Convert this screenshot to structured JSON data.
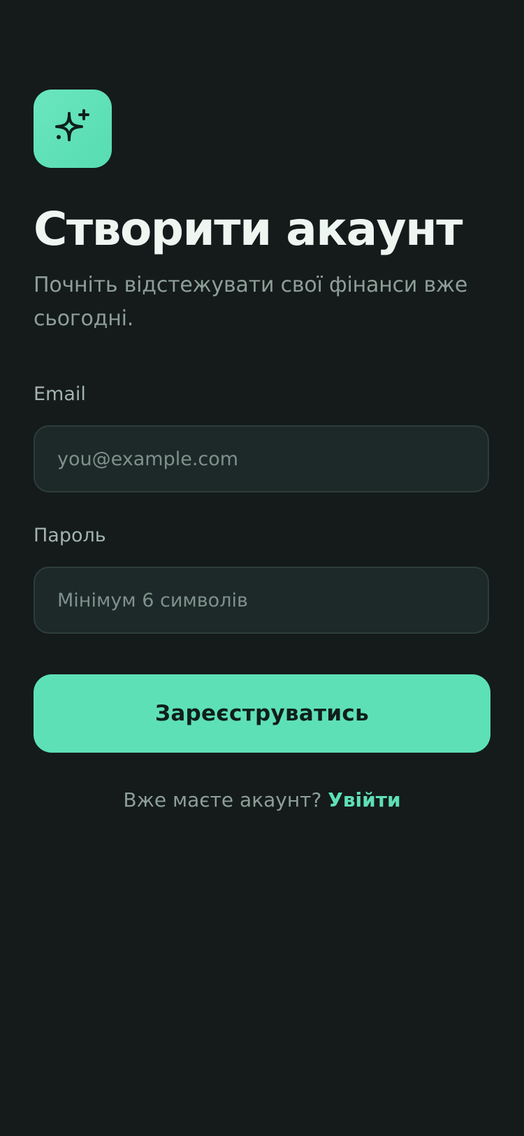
{
  "app": {
    "logo_icon": "sparkles-icon",
    "accent_color": "#5ee0b6"
  },
  "header": {
    "title": "Створити акаунт",
    "subtitle": "Почніть відстежувати свої фінанси вже сьогодні."
  },
  "form": {
    "email": {
      "label": "Email",
      "placeholder": "you@example.com",
      "value": ""
    },
    "password": {
      "label": "Пароль",
      "placeholder": "Мінімум 6 символів",
      "value": ""
    },
    "submit_label": "Зареєструватись"
  },
  "footer": {
    "prompt": "Вже маєте акаунт?",
    "login_label": "Увійти"
  }
}
